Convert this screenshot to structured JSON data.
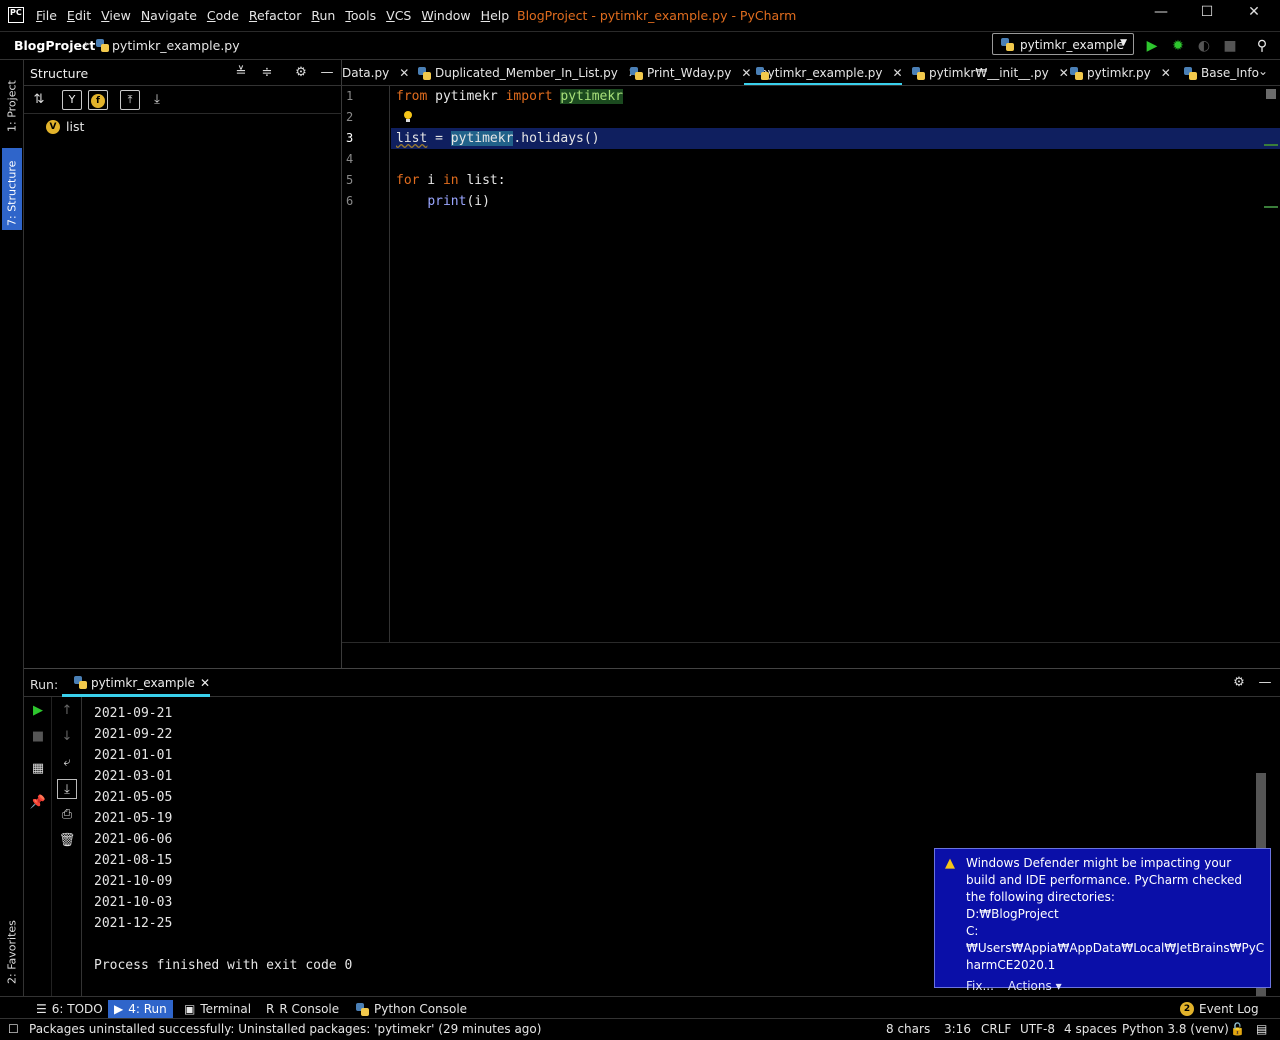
{
  "app": {
    "logo_text": "PC",
    "menu": [
      "File",
      "Edit",
      "View",
      "Navigate",
      "Code",
      "Refactor",
      "Run",
      "Tools",
      "VCS",
      "Window",
      "Help"
    ],
    "window_title": "BlogProject - pytimkr_example.py - PyCharm",
    "window_buttons": {
      "minimize": "—",
      "maximize": "☐",
      "close": "✕"
    }
  },
  "navbar": {
    "project": "BlogProject",
    "file": "pytimkr_example.py",
    "run_config": "pytimkr_example"
  },
  "left_strip": {
    "project_tab": "1: Project",
    "structure_tab": "7: Structure",
    "favorites_tab": "2: Favorites"
  },
  "structure": {
    "title": "Structure",
    "items": [
      {
        "badge": "V",
        "label": "list"
      }
    ]
  },
  "tabs": [
    {
      "label": "Data.py",
      "active": false
    },
    {
      "label": "Duplicated_Member_In_List.py",
      "active": false
    },
    {
      "label": "Print_Wday.py",
      "active": false
    },
    {
      "label": "pytimkr_example.py",
      "active": true
    },
    {
      "label": "pytimkr₩__init__.py",
      "active": false
    },
    {
      "label": "pytimkr.py",
      "active": false
    },
    {
      "label": "Base_Info",
      "active": false
    }
  ],
  "editor": {
    "line_numbers": [
      "1",
      "2",
      "3",
      "4",
      "5",
      "6"
    ],
    "lines": {
      "l1_from": "from",
      "l1_mod": "pytimekr",
      "l1_import": "import",
      "l1_mod2": "pytimekr",
      "l3_var": "list",
      "l3_eq": " = ",
      "l3_sel": "pytimekr",
      "l3_rest": ".holidays()",
      "l5_for": "for",
      "l5_i": " i ",
      "l5_in": "in",
      "l5_rest": " list:",
      "l6_print": "print",
      "l6_rest": "(i)"
    }
  },
  "run": {
    "label": "Run:",
    "tab": "pytimkr_example",
    "output": "2021-09-21\n2021-09-22\n2021-01-01\n2021-03-01\n2021-05-05\n2021-05-19\n2021-06-06\n2021-08-15\n2021-10-09\n2021-10-03\n2021-12-25\n\nProcess finished with exit code 0"
  },
  "notification": {
    "text_1": "Windows Defender might be impacting your",
    "text_2": "build and IDE performance. PyCharm checked",
    "text_3": "the following directories:",
    "dir_1": "D:₩BlogProject",
    "dir_2a": "C:₩Users₩Appia₩AppData₩Local₩JetBrains₩PyC",
    "dir_2b": "harmCE2020.1",
    "fix": "Fix...",
    "actions": "Actions ▾"
  },
  "bottom_tools": {
    "todo": "6: TODO",
    "run": "4: Run",
    "terminal": "Terminal",
    "r_console": "R Console",
    "python_console": "Python Console",
    "event_log": "Event Log",
    "event_count": "2"
  },
  "status": {
    "message": "Packages uninstalled successfully: Uninstalled packages: 'pytimekr' (29 minutes ago)",
    "chars": "8 chars",
    "position": "3:16",
    "line_sep": "CRLF",
    "encoding": "UTF-8",
    "indent": "4 spaces",
    "interpreter": "Python 3.8 (venv)"
  },
  "colors": {
    "accent": "#2f65ca",
    "keyword": "#e06c1e",
    "tab_underline": "#3ad0ec",
    "notification": "#0a0fa8"
  }
}
